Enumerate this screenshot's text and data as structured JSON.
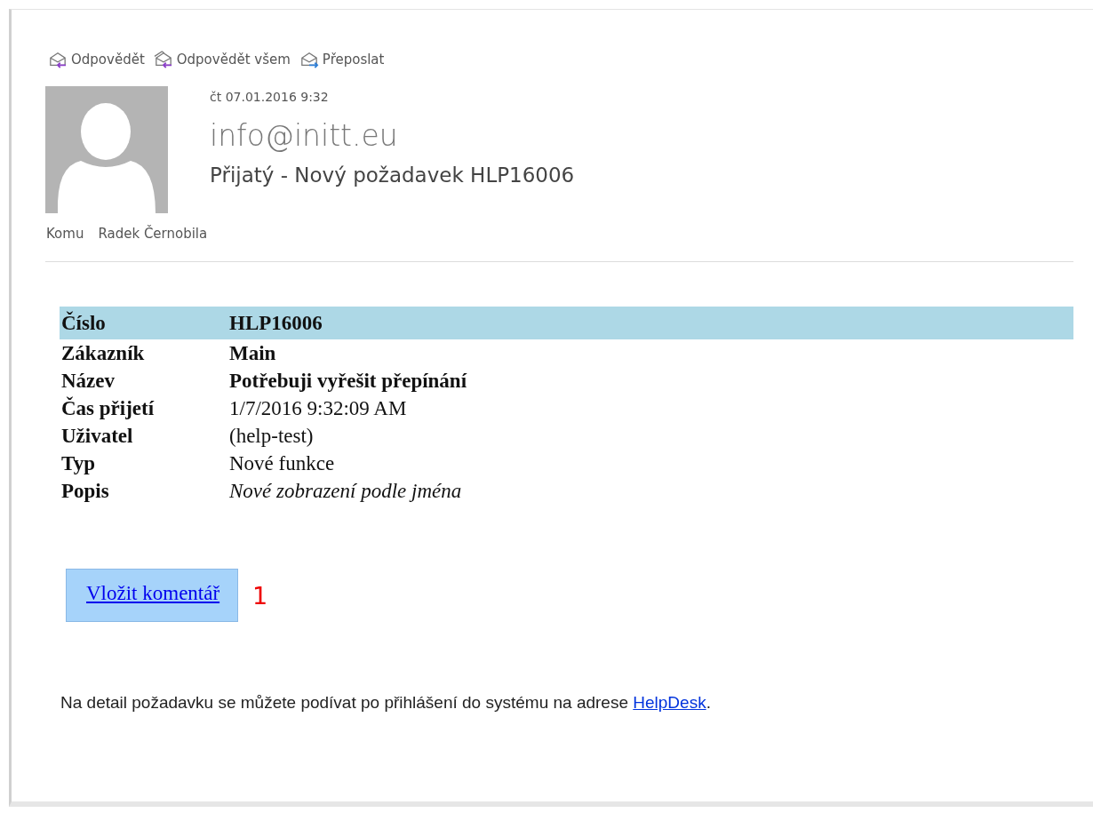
{
  "toolbar": [
    {
      "kind": "reply",
      "label": "Odpovědět"
    },
    {
      "kind": "reply_all",
      "label": "Odpovědět všem"
    },
    {
      "kind": "forward",
      "label": "Přeposlat"
    }
  ],
  "message": {
    "date": "čt 07.01.2016 9:32",
    "sender": "info@initt.eu",
    "subject": "Přijatý - Nový požadavek HLP16006",
    "to_label": "Komu",
    "to": "Radek Černobila"
  },
  "details": [
    {
      "label": "Číslo",
      "value": "HLP16006",
      "kind": "bold",
      "highlighted": true
    },
    {
      "label": "Zákazník",
      "value": "Main",
      "kind": "bold",
      "highlighted": false
    },
    {
      "label": "Název",
      "value": "Potřebuji vyřešit přepínání",
      "kind": "bold",
      "highlighted": false
    },
    {
      "label": "Čas přijetí",
      "value": "1/7/2016 9:32:09 AM",
      "kind": "plain",
      "highlighted": false
    },
    {
      "label": "Uživatel",
      "value": "(help-test)",
      "kind": "plain",
      "highlighted": false
    },
    {
      "label": "Typ",
      "value": "Nové funkce",
      "kind": "plain",
      "highlighted": false
    },
    {
      "label": "Popis",
      "value": "Nové zobrazení podle jména",
      "kind": "italic",
      "highlighted": false
    }
  ],
  "comment_button": {
    "label": "Vložit komentář",
    "annotation": "1"
  },
  "footer": {
    "text": "Na detail požadavku se můžete podívat po přihlášení do systému na adrese ",
    "link": "HelpDesk",
    "end": "."
  }
}
